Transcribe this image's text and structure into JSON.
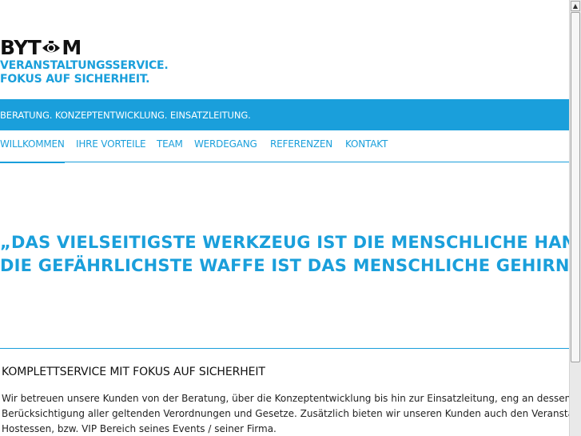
{
  "logo": {
    "word_before": "BYT",
    "word_after": "M",
    "tagline_1": "VERANSTALTUNGSSERVICE.",
    "tagline_2": "FOKUS AUF SICHERHEIT."
  },
  "banner": {
    "text": "BERATUNG. KONZEPTENTWICKLUNG. EINSATZLEITUNG."
  },
  "nav": {
    "items": [
      {
        "label": "WILLKOMMEN"
      },
      {
        "label": "IHRE VORTEILE"
      },
      {
        "label": "TEAM"
      },
      {
        "label": "WERDEGANG"
      },
      {
        "label": "REFERENZEN"
      },
      {
        "label": "KONTAKT"
      }
    ]
  },
  "quote": {
    "line_1": "„DAS VIELSEITIGSTE WERKZEUG IST DIE MENSCHLICHE HAND,",
    "line_2": "DIE GEFÄHRLICHSTE WAFFE IST DAS MENSCHLICHE GEHIRN.“"
  },
  "section": {
    "title": "KOMPLETTSERVICE MIT FOKUS AUF SICHERHEIT",
    "line_1": "Wir betreuen unsere Kunden von der Beratung, über die Konzeptentwicklung bis hin zur Einsatzleitung, eng an dessen Vorgaben und unter",
    "line_2": "Berücksichtigung aller geltenden Verordnungen und Gesetze. Zusätzlich bieten wir unseren Kunden auch den Veranstaltungsservice für",
    "line_3": "Hostessen, bzw. VIP Bereich seines Events / seiner Firma."
  },
  "scrollbar": {
    "up_arrow": "▲"
  },
  "colors": {
    "accent": "#1a9fdb",
    "text": "#222222"
  }
}
